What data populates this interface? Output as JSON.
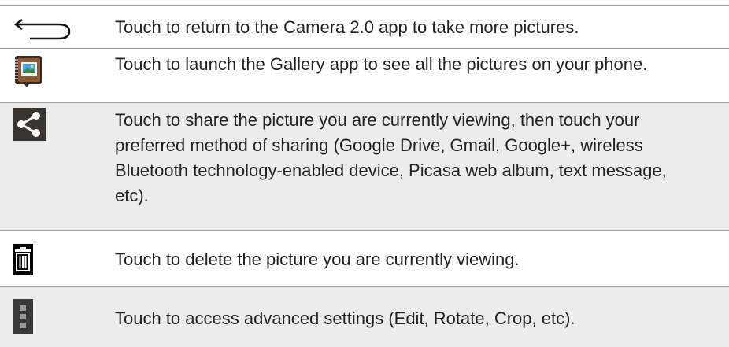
{
  "rows": [
    {
      "icon": "back-arrow-icon",
      "text": "Touch to return to the Camera 2.0 app to take more pictures."
    },
    {
      "icon": "gallery-icon",
      "text": "Touch to launch the Gallery app to see all the pictures on your phone."
    },
    {
      "icon": "share-icon",
      "text": "Touch to share the picture you are currently viewing, then touch your preferred method of sharing (Google Drive, Gmail, Google+, wireless Bluetooth technology-enabled device, Picasa web album, text message, etc)."
    },
    {
      "icon": "trash-icon",
      "text": "Touch to delete the picture you are currently viewing."
    },
    {
      "icon": "menu-more-icon",
      "text": "Touch to access advanced settings (Edit, Rotate, Crop, etc)."
    }
  ]
}
